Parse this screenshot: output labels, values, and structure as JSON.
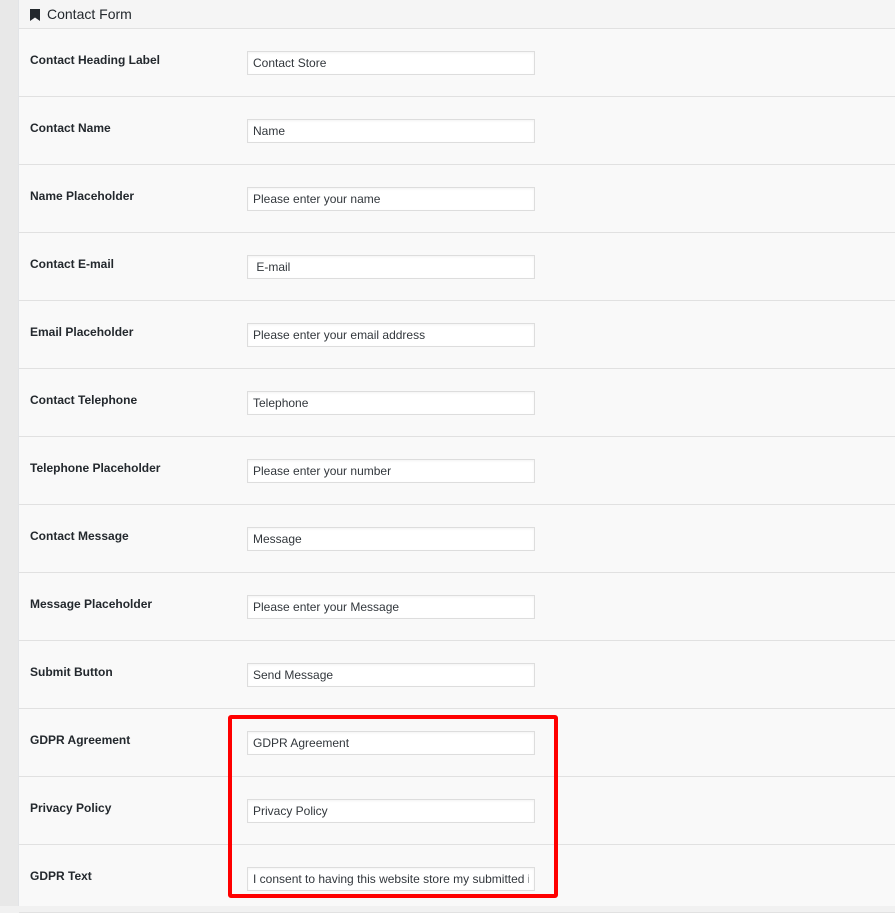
{
  "panel": {
    "title": "Contact Form",
    "icon": "bookmark-icon"
  },
  "fields": [
    {
      "label": "Contact Heading Label",
      "value": "Contact Store"
    },
    {
      "label": "Contact Name",
      "value": "Name"
    },
    {
      "label": "Name Placeholder",
      "value": "Please enter your name"
    },
    {
      "label": "Contact E-mail",
      "value": " E-mail"
    },
    {
      "label": "Email Placeholder",
      "value": "Please enter your email address"
    },
    {
      "label": "Contact Telephone",
      "value": "Telephone"
    },
    {
      "label": "Telephone Placeholder",
      "value": "Please enter your number"
    },
    {
      "label": "Contact Message",
      "value": "Message"
    },
    {
      "label": "Message Placeholder",
      "value": "Please enter your Message"
    },
    {
      "label": "Submit Button",
      "value": "Send Message"
    },
    {
      "label": "GDPR Agreement",
      "value": "GDPR Agreement"
    },
    {
      "label": "Privacy Policy",
      "value": "Privacy Policy"
    },
    {
      "label": "GDPR Text",
      "value": "I consent to having this website store my submitted information"
    }
  ],
  "colors": {
    "highlight": "#ff0000",
    "panel_bg": "#f9f9f9",
    "border": "#e1e1e1"
  }
}
